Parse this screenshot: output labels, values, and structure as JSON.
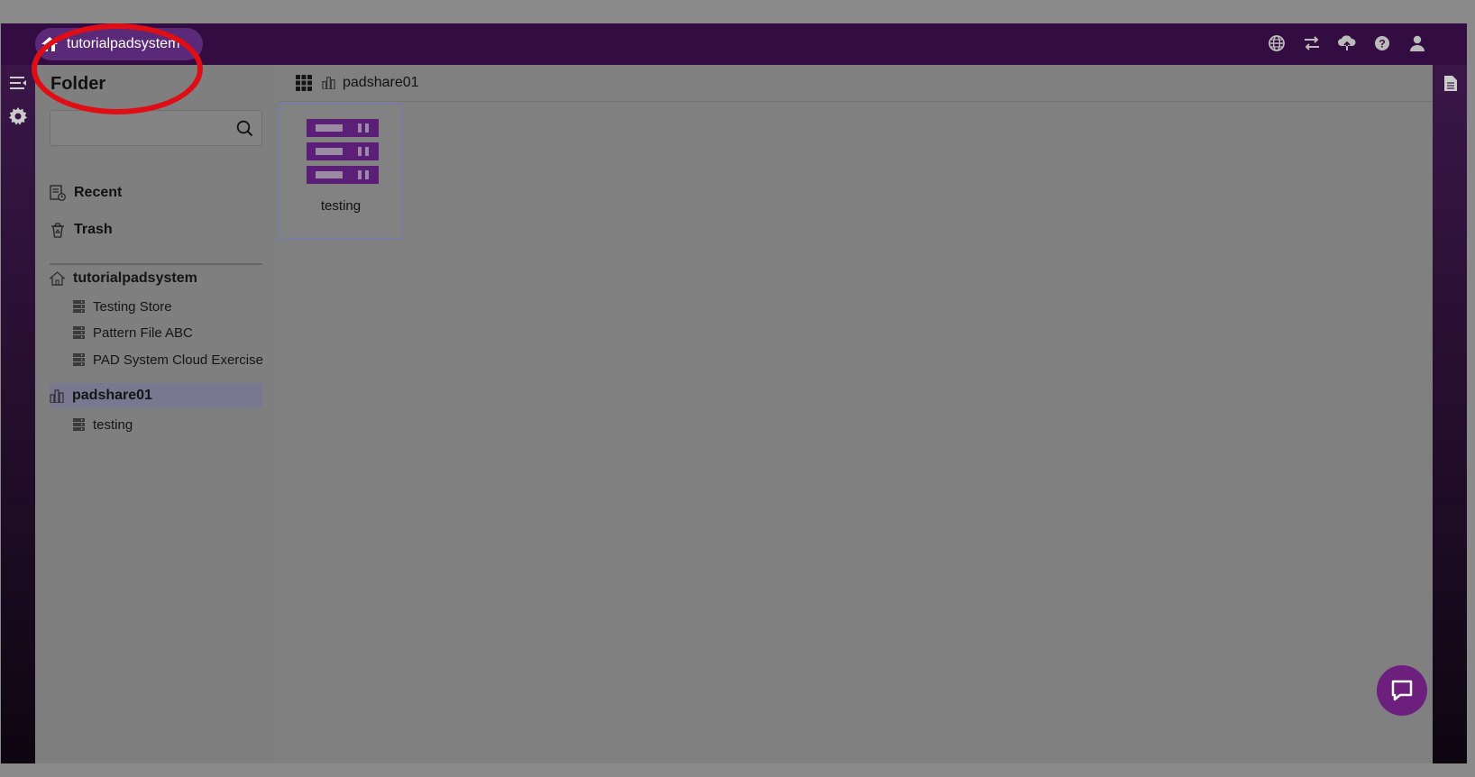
{
  "header": {
    "home_label": "tutorialpadsystem",
    "icons": [
      "globe-icon",
      "transfer-icon",
      "cloud-upload-icon",
      "help-icon",
      "user-icon"
    ]
  },
  "sidebar": {
    "title": "Folder",
    "search": {
      "value": "",
      "placeholder": ""
    },
    "nav": [
      {
        "label": "Recent",
        "icon": "recent-icon"
      },
      {
        "label": "Trash",
        "icon": "trash-icon"
      }
    ],
    "tree": {
      "root_1": {
        "label": "tutorialpadsystem",
        "children": [
          "Testing Store",
          "Pattern File ABC",
          "PAD System Cloud Exercise"
        ]
      },
      "root_2": {
        "label": "padshare01",
        "selected": true,
        "children": [
          "testing"
        ]
      }
    }
  },
  "main": {
    "breadcrumb": "padshare01",
    "tiles": [
      {
        "label": "testing",
        "icon": "server-icon"
      }
    ]
  },
  "colors": {
    "topbar": "#330c41",
    "accent": "#5a2a78",
    "tile_icon": "#5b1f78",
    "highlight": "#e00d14"
  }
}
